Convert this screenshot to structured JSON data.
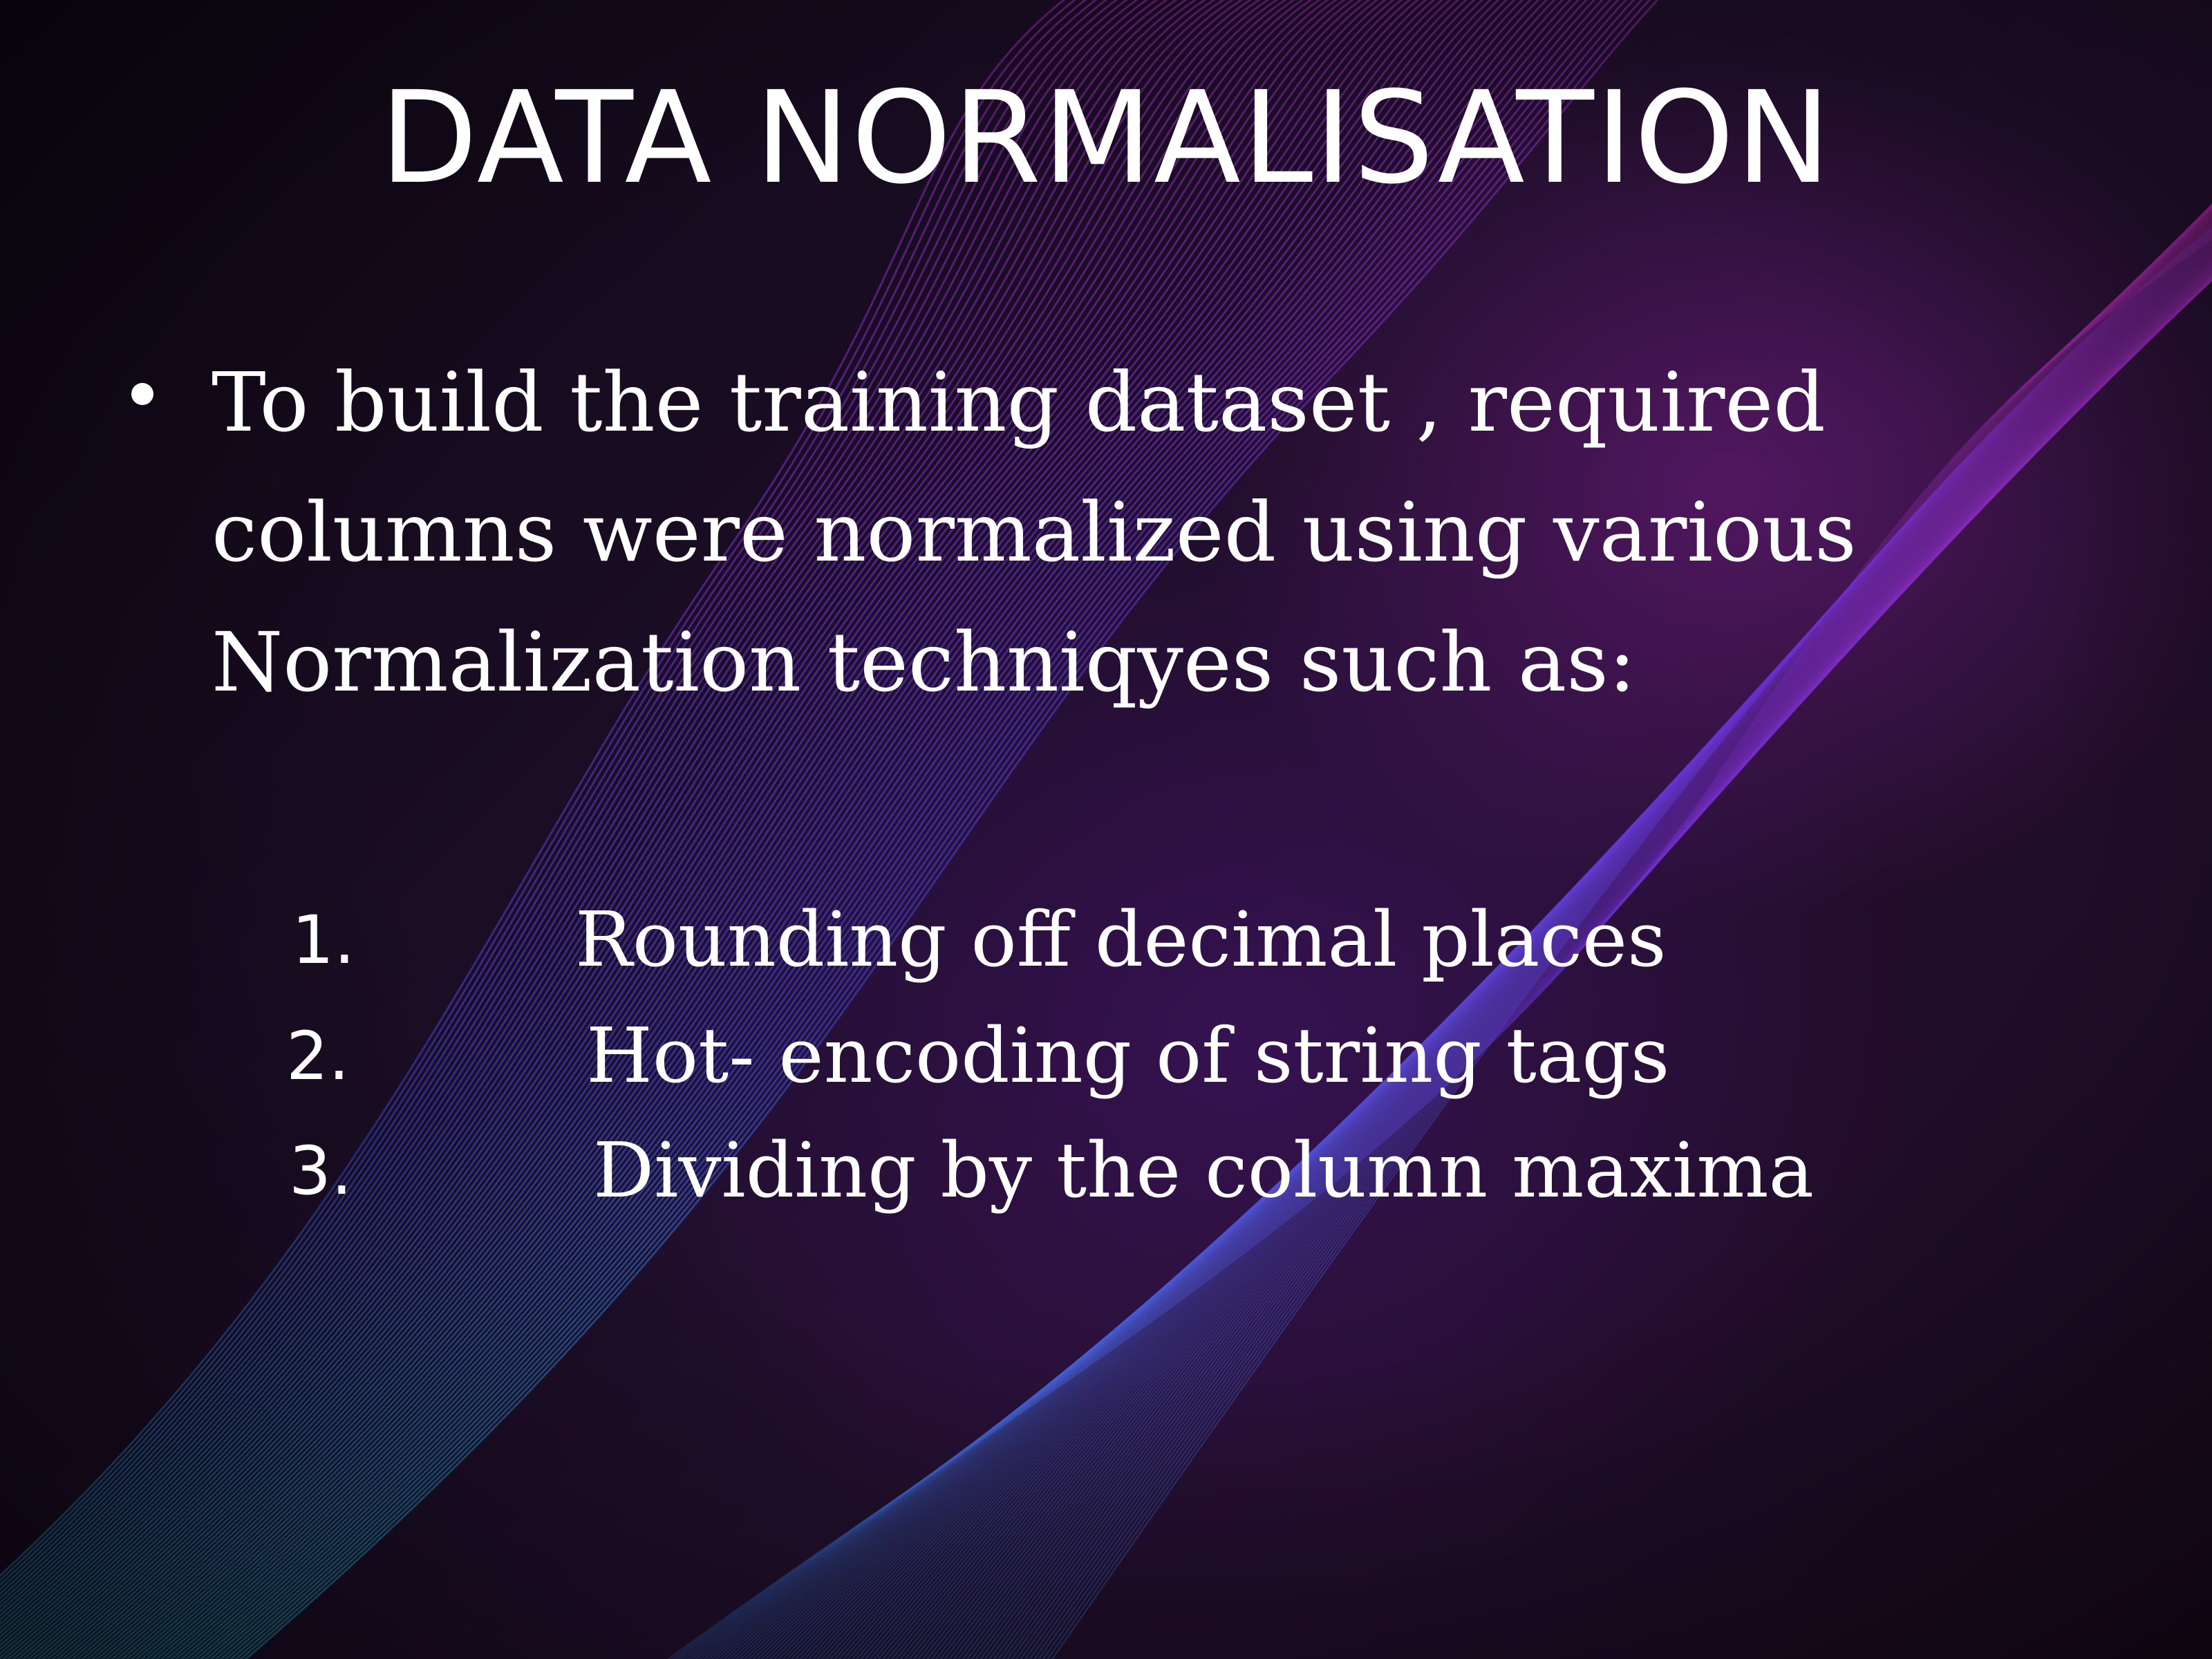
{
  "slide": {
    "title": "DATA NORMALISATION",
    "bullet": "To build the training dataset , required columns were normalized using various Normalization techniqyes such as:",
    "list": [
      {
        "number": "1.",
        "text": "Rounding off decimal places"
      },
      {
        "number": "2.",
        "text": "Hot- encoding of string tags"
      },
      {
        "number": "3.",
        "text": "Dividing by  the column maxima"
      }
    ]
  },
  "colors": {
    "background": "#150b1c",
    "text": "#ffffff",
    "wave_cyan": "#1fc9d8",
    "wave_blue": "#3a4bd8",
    "wave_violet": "#7b2fd0",
    "wave_magenta": "#a0209e"
  }
}
